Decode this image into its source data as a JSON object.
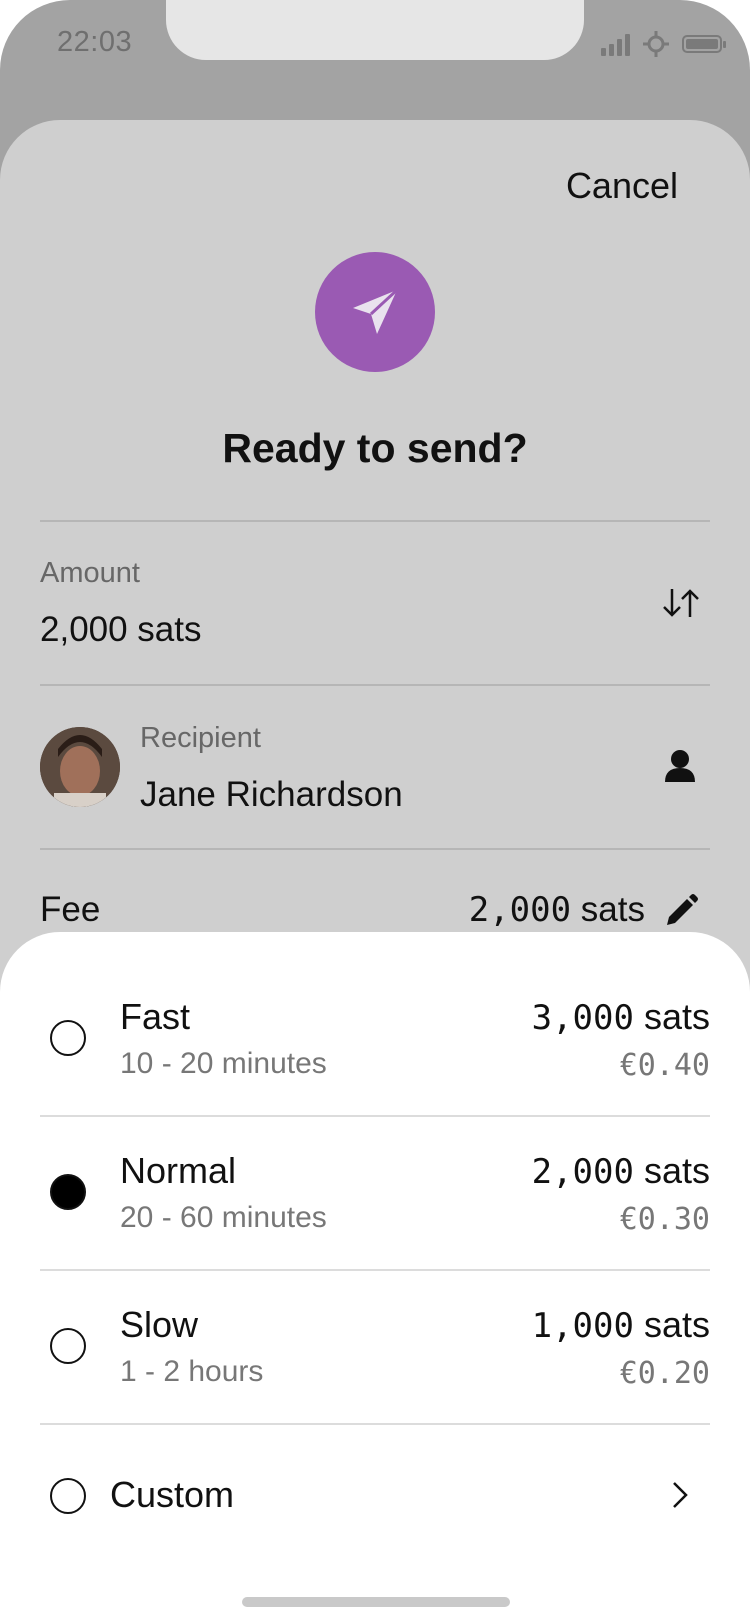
{
  "status_bar": {
    "time": "22:03"
  },
  "header": {
    "cancel_label": "Cancel",
    "title": "Ready to send?"
  },
  "amount": {
    "label": "Amount",
    "value": "2,000 sats"
  },
  "recipient": {
    "label": "Recipient",
    "name": "Jane Richardson"
  },
  "fee": {
    "label": "Fee",
    "value_number": "2,000",
    "value_unit": "sats"
  },
  "fee_options": [
    {
      "name": "Fast",
      "time": "10 - 20 minutes",
      "sats_number": "3,000",
      "sats_unit": "sats",
      "eur": "€0.40",
      "selected": false
    },
    {
      "name": "Normal",
      "time": "20 - 60 minutes",
      "sats_number": "2,000",
      "sats_unit": "sats",
      "eur": "€0.30",
      "selected": true
    },
    {
      "name": "Slow",
      "time": "1 - 2 hours",
      "sats_number": "1,000",
      "sats_unit": "sats",
      "eur": "€0.20",
      "selected": false
    }
  ],
  "custom_option": {
    "label": "Custom"
  },
  "colors": {
    "accent": "#9a5ab3",
    "overlay_bg": "#cfcfcf",
    "sheet_bg": "#ffffff"
  },
  "icons": [
    "send-icon",
    "swap-icon",
    "person-icon",
    "pencil-icon",
    "chevron-right-icon"
  ]
}
